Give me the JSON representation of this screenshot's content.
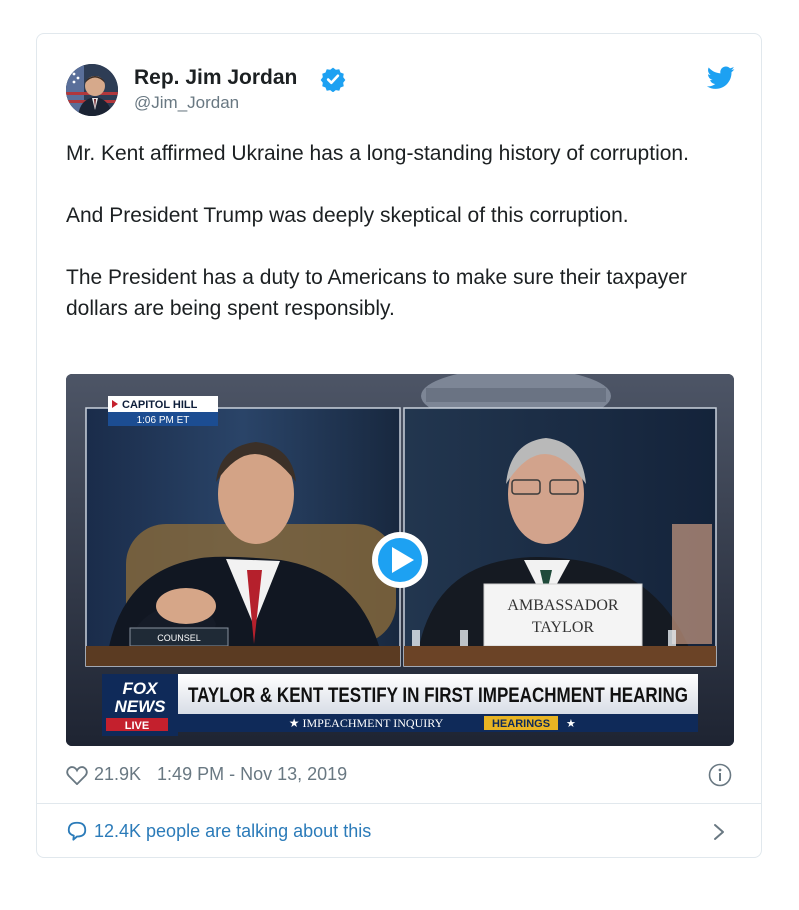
{
  "author": {
    "name": "Rep. Jim Jordan",
    "handle": "@Jim_Jordan"
  },
  "tweet": {
    "paragraphs": [
      "Mr. Kent affirmed Ukraine has a long-standing history of corruption.",
      "And President Trump was deeply skeptical of this corruption.",
      "The President has a duty to Americans to make sure their taxpayer dollars are being spent responsibly."
    ]
  },
  "media": {
    "location_tag": "CAPITOL HILL",
    "time_tag": "1:06 PM ET",
    "left_nameplate": "COUNSEL",
    "right_nameplate_line1": "AMBASSADOR",
    "right_nameplate_line2": "TAYLOR",
    "network_line1": "FOX",
    "network_line2": "NEWS",
    "network_line3": "LIVE",
    "headline": "TAYLOR & KENT TESTIFY IN FIRST IMPEACHMENT HEARING",
    "ticker_main": "★ IMPEACHMENT INQUIRY",
    "ticker_tag": "HEARINGS",
    "ticker_end": "★"
  },
  "footer": {
    "likes": "21.9K",
    "timestamp": "1:49 PM - Nov 13, 2019",
    "talking": "12.4K people are talking about this"
  },
  "colors": {
    "link": "#2b7bb9",
    "verified": "#1da1f2",
    "muted": "#697882",
    "text": "#1c2022"
  },
  "icons": [
    "verified-icon",
    "twitter-bird-icon",
    "play-icon",
    "heart-icon",
    "info-icon",
    "comment-bubble-icon",
    "chevron-right-icon"
  ]
}
